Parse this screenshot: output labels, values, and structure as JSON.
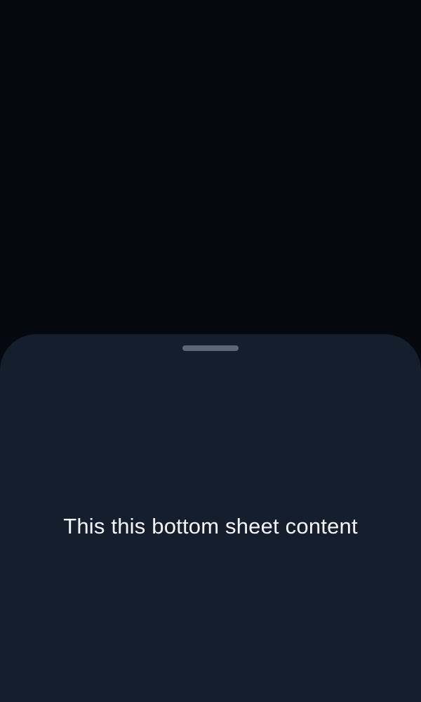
{
  "bottom_sheet": {
    "content_text": "This this bottom sheet content"
  },
  "colors": {
    "backdrop": "#05090f",
    "sheet_background": "#151e2c",
    "handle": "#5d6673",
    "text": "#f4f6f9"
  }
}
